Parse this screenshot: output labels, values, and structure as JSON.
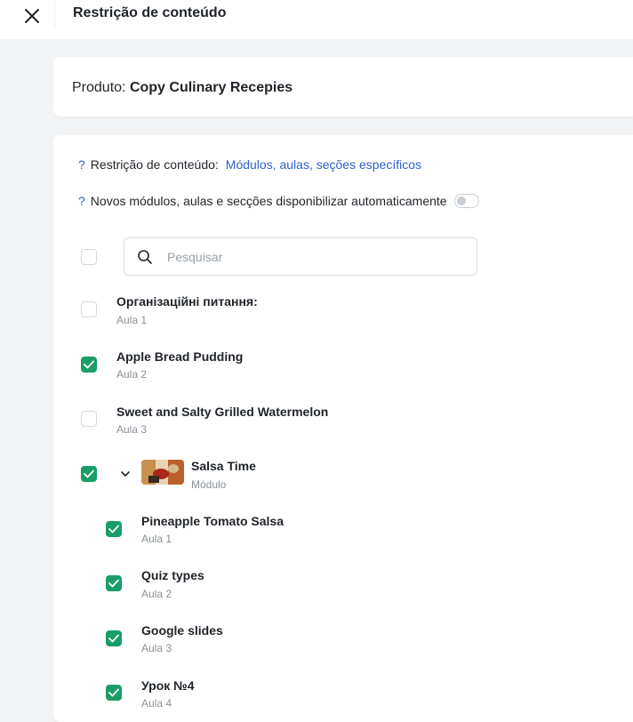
{
  "header": {
    "title": "Restrição de conteúdo"
  },
  "product": {
    "label": "Produto:",
    "name": "Copy Culinary Recepies"
  },
  "restriction": {
    "help": "?",
    "label": "Restrição de conteúdo:",
    "value": "Módulos, aulas, seções específicos"
  },
  "auto": {
    "help": "?",
    "label": "Novos módulos, aulas e secções disponibilizar automaticamente",
    "enabled": false
  },
  "search": {
    "placeholder": "Pesquisar"
  },
  "items": [
    {
      "title": "Організаційні питання:",
      "sub": "Aula 1",
      "checked": false
    },
    {
      "title": "Apple Bread Pudding",
      "sub": "Aula 2",
      "checked": true
    },
    {
      "title": "Sweet and Salty Grilled Watermelon",
      "sub": "Aula 3",
      "checked": false
    },
    {
      "title": "Salsa Time",
      "sub": "Módulo",
      "checked": true,
      "expanded": true
    },
    {
      "title": "Pineapple Tomato Salsa",
      "sub": "Aula 1",
      "checked": true
    },
    {
      "title": "Quiz types",
      "sub": "Aula 2",
      "checked": true
    },
    {
      "title": "Google slides",
      "sub": "Aula 3",
      "checked": true
    },
    {
      "title": "Урок №4",
      "sub": "Aula 4",
      "checked": true
    }
  ],
  "colors": {
    "accent": "#1a9e68",
    "link": "#2f5fd0"
  }
}
